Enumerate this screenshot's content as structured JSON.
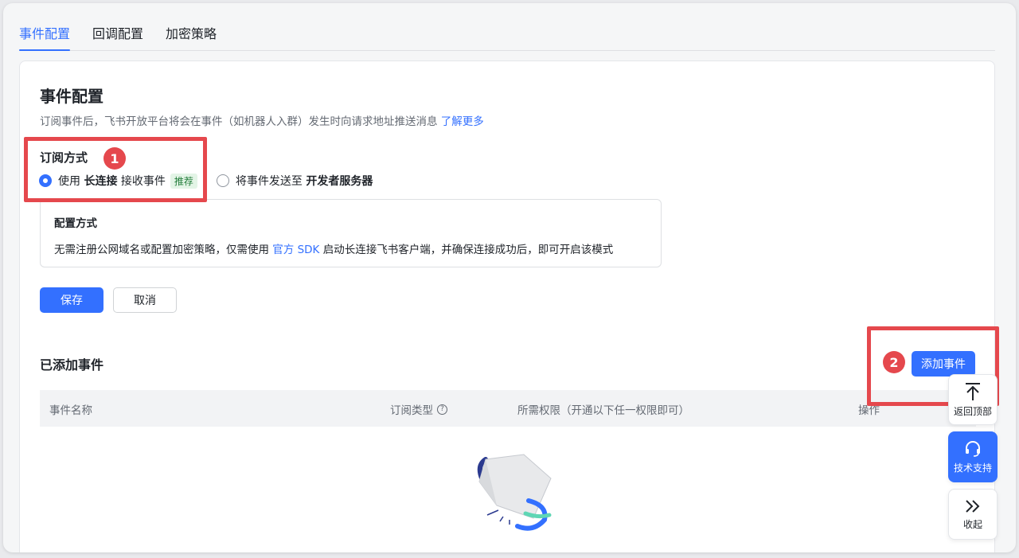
{
  "tabs": [
    {
      "label": "事件配置",
      "active": true
    },
    {
      "label": "回调配置",
      "active": false
    },
    {
      "label": "加密策略",
      "active": false
    }
  ],
  "section": {
    "title": "事件配置",
    "desc": "订阅事件后，飞书开放平台将会在事件（如机器人入群）发生时向请求地址推送消息",
    "learn_more": "了解更多"
  },
  "subscription": {
    "label": "订阅方式",
    "option1": {
      "pre": "使用",
      "bold": "长连接",
      "post": "接收事件",
      "tag": "推荐",
      "checked": true
    },
    "option2": {
      "pre": "将事件发送至",
      "bold": "开发者服务器",
      "checked": false
    }
  },
  "config": {
    "title": "配置方式",
    "text_pre": "无需注册公网域名或配置加密策略，仅需使用",
    "link": "官方 SDK",
    "text_post": "启动长连接飞书客户端，并确保连接成功后，即可开启该模式"
  },
  "buttons": {
    "save": "保存",
    "cancel": "取消",
    "add_event": "添加事件"
  },
  "added": {
    "title": "已添加事件",
    "columns": [
      "事件名称",
      "订阅类型",
      "所需权限（开通以下任一权限即可）",
      "操作"
    ]
  },
  "annotations": {
    "badge1": "1",
    "badge2": "2",
    "color": "#e5484d"
  },
  "float": {
    "back_top": "返回顶部",
    "support": "技术支持",
    "collapse": "收起"
  },
  "colors": {
    "primary": "#3370ff",
    "tag_bg": "#e3f4e6",
    "tag_text": "#237d3b"
  }
}
